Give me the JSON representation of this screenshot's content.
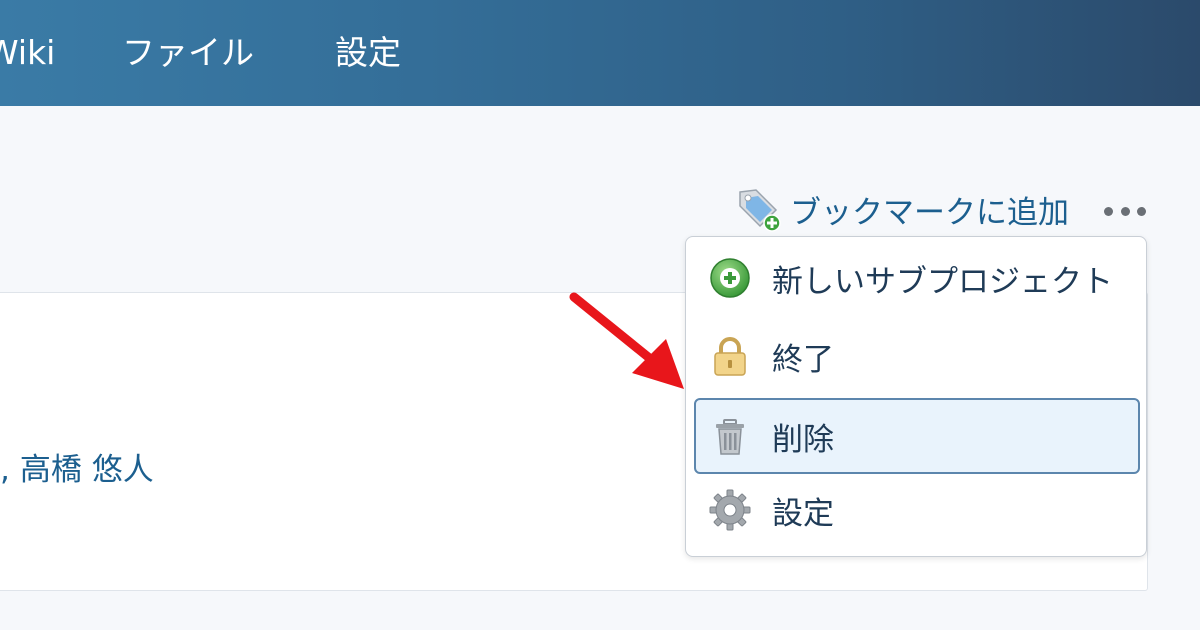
{
  "nav": {
    "items": [
      {
        "label": "Wiki"
      },
      {
        "label": "ファイル"
      },
      {
        "label": "設定"
      }
    ]
  },
  "actions": {
    "bookmark_label": "ブックマークに追加",
    "more_icon": "ellipsis-icon"
  },
  "content": {
    "members_separator": ",",
    "member_name": "高橋 悠人"
  },
  "menu": {
    "items": [
      {
        "label": "新しいサブプロジェクト",
        "icon": "add-circle-icon"
      },
      {
        "label": "終了",
        "icon": "lock-icon"
      },
      {
        "label": "削除",
        "icon": "trash-icon",
        "highlighted": true
      },
      {
        "label": "設定",
        "icon": "gear-icon"
      }
    ]
  },
  "colors": {
    "nav_gradient_start": "#3a7ba6",
    "nav_gradient_end": "#2b4a6b",
    "link": "#1c5f8f",
    "highlight_bg": "#e9f3fc",
    "highlight_border": "#5c86ad",
    "annotation_arrow": "#e8161b"
  }
}
